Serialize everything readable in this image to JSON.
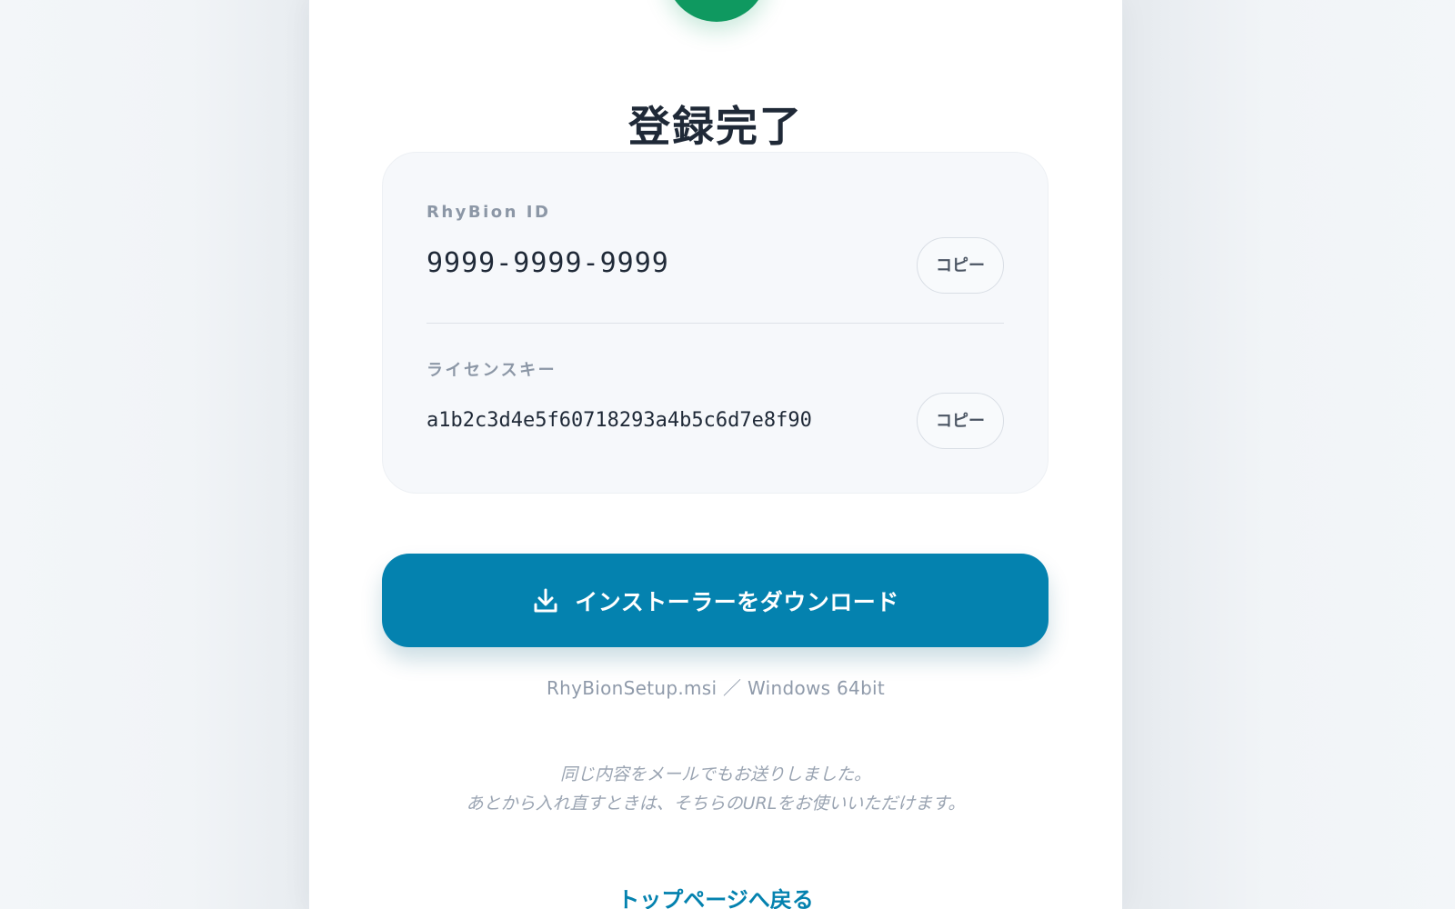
{
  "page": {
    "title": "登録完了",
    "icon": "success-check-icon",
    "accent_color": "#0482af",
    "success_color": "#0f9960"
  },
  "credentials": {
    "id": {
      "label": "RhyBion ID",
      "value": "9999-9999-9999",
      "copy_label": "コピー"
    },
    "license": {
      "label": "ライセンスキー",
      "value": "a1b2c3d4e5f60718293a4b5c6d7e8f90",
      "copy_label": "コピー"
    }
  },
  "download": {
    "label": "インストーラーをダウンロード",
    "icon": "download-icon",
    "file_info": "RhyBionSetup.msi ／ Windows 64bit"
  },
  "note": {
    "line1": "同じ内容をメールでもお送りしました。",
    "line2": "あとから入れ直すときは、そちらのURLをお使いいただけます。"
  },
  "footer": {
    "back_link": "トップページへ戻る"
  }
}
